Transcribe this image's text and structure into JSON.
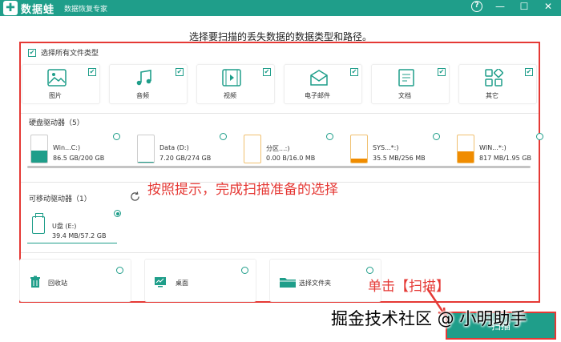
{
  "app": {
    "name": "数据蛙",
    "subtitle": "数据恢复专家",
    "window_controls": [
      "?",
      "—",
      "☐",
      "✕"
    ]
  },
  "instruction": "选择要扫描的丢失数据的数据类型和路径。",
  "select_all": {
    "label": "选择所有文件类型",
    "checked": true
  },
  "file_types": [
    {
      "label": "图片",
      "icon": "image-icon",
      "checked": true
    },
    {
      "label": "音频",
      "icon": "music-icon",
      "checked": true
    },
    {
      "label": "视频",
      "icon": "video-icon",
      "checked": true
    },
    {
      "label": "电子邮件",
      "icon": "email-icon",
      "checked": true
    },
    {
      "label": "文档",
      "icon": "document-icon",
      "checked": true
    },
    {
      "label": "其它",
      "icon": "other-icon",
      "checked": true
    }
  ],
  "hard_drives": {
    "title": "硬盘驱动器（5）",
    "items": [
      {
        "name": "Win...C:)",
        "size": "86.5 GB/200 GB",
        "usage": 0.43,
        "color": "#1f9e8a"
      },
      {
        "name": "Data (D:)",
        "size": "7.20 GB/274 GB",
        "usage": 0.03,
        "color": "#1f9e8a"
      },
      {
        "name": "分区...:)",
        "size": "0.00  B/16.0 MB",
        "usage": 0.0,
        "color": "#f0a030"
      },
      {
        "name": "SYS...*:)",
        "size": "35.5 MB/256 MB",
        "usage": 0.14,
        "color": "#f08c00"
      },
      {
        "name": "WIN...*:)",
        "size": "817 MB/1.95 GB",
        "usage": 0.42,
        "color": "#f08c00"
      }
    ]
  },
  "annotation_main": "按照提示，完成扫描准备的选择",
  "removable": {
    "title": "可移动驱动器（1）",
    "items": [
      {
        "name": "U盘 (E:)",
        "size": "39.4 MB/57.2 GB",
        "selected": true
      }
    ]
  },
  "locations": [
    {
      "label": "回收站",
      "icon": "recycle-bin-icon"
    },
    {
      "label": "桌面",
      "icon": "desktop-icon"
    },
    {
      "label": "选择文件夹",
      "icon": "folder-icon"
    }
  ],
  "annotation_scan": "单击【扫描】",
  "scan_button": "扫描",
  "watermark": "掘金技术社区 @ 小明助手",
  "colors": {
    "accent": "#1f9e8a",
    "annotation": "#e53935"
  }
}
